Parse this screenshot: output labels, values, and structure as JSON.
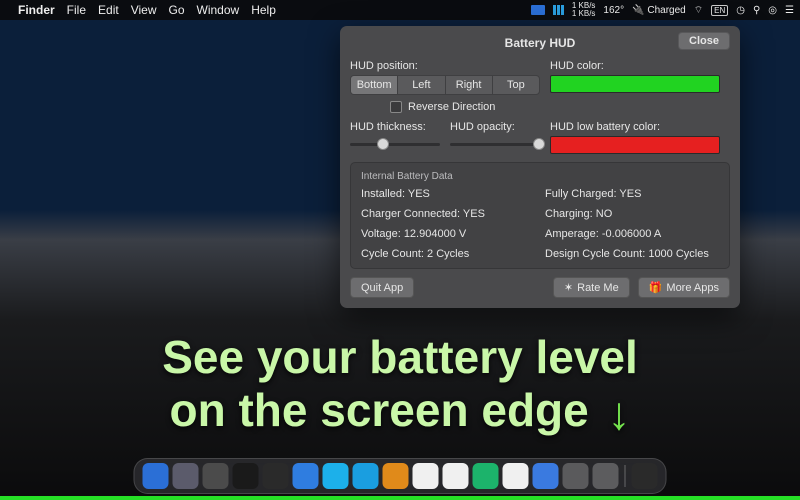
{
  "menubar": {
    "app": "Finder",
    "items": [
      "File",
      "Edit",
      "View",
      "Go",
      "Window",
      "Help"
    ],
    "right": {
      "net": "1 KB/s\n1 KB/s",
      "temp": "162°",
      "battery": "Charged"
    }
  },
  "window": {
    "title": "Battery HUD",
    "close": "Close",
    "hud_position_label": "HUD position:",
    "positions": [
      "Bottom",
      "Left",
      "Right",
      "Top"
    ],
    "selected_position": 0,
    "reverse_label": "Reverse Direction",
    "hud_color_label": "HUD color:",
    "hud_low_label": "HUD low battery color:",
    "thickness_label": "HUD thickness:",
    "opacity_label": "HUD opacity:",
    "thickness_pct": 30,
    "opacity_pct": 92,
    "panel_title": "Internal Battery Data",
    "data": {
      "installed": "Installed: YES",
      "fully_charged": "Fully Charged: YES",
      "charger": "Charger Connected: YES",
      "charging": "Charging: NO",
      "voltage": "Voltage: 12.904000 V",
      "amperage": "Amperage: -0.006000 A",
      "cycles": "Cycle Count: 2 Cycles",
      "design": "Design Cycle Count: 1000 Cycles"
    },
    "quit": "Quit App",
    "rate": "Rate Me",
    "more": "More Apps"
  },
  "promo": {
    "line1": "See your battery level",
    "line2": "on the screen edge"
  },
  "colors": {
    "hud": "#21d321",
    "hud_low": "#e62020"
  },
  "dock_apps": [
    "#2b6fd6",
    "#5b5b6b",
    "#4b4b4b",
    "#1a1a1a",
    "#2a2a2a",
    "#2f7de0",
    "#1cb0ea",
    "#1a9ee0",
    "#e08a1a",
    "#f0f0f0",
    "#f0f0f0",
    "#1cb36b",
    "#f0f0f0",
    "#3a7ae0",
    "#5a5a5c",
    "#5c5c5e",
    "#2a2a2a"
  ]
}
